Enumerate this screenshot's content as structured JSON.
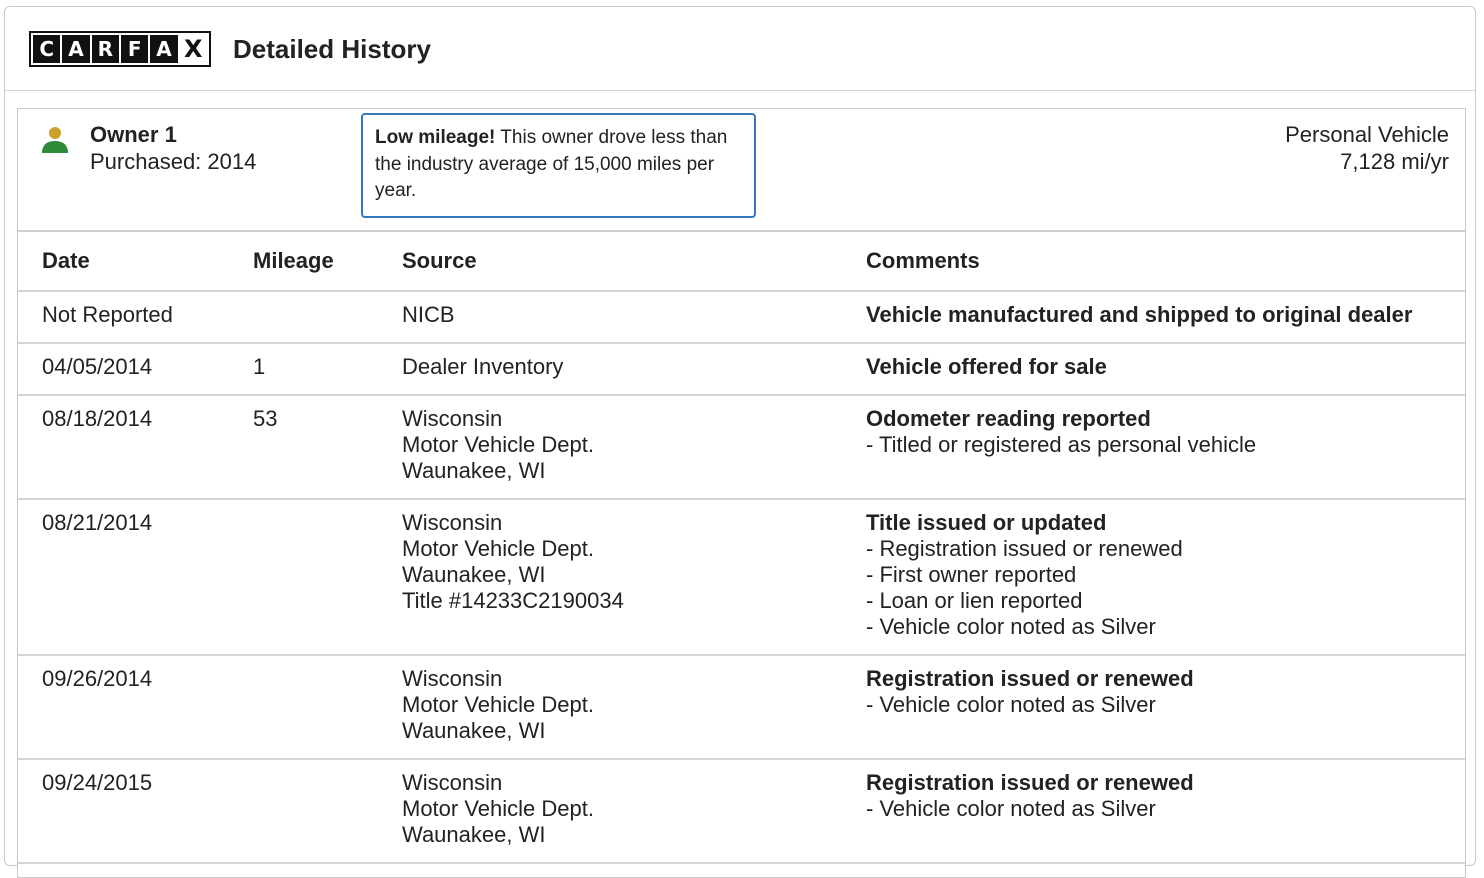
{
  "header": {
    "logo_letters": [
      "C",
      "A",
      "R",
      "F",
      "A",
      "X"
    ],
    "title": "Detailed History"
  },
  "owner": {
    "name": "Owner 1",
    "purchased": "Purchased: 2014",
    "icon": "person-icon",
    "icon_head_color": "#c9a227",
    "icon_body_color": "#2e8b3a",
    "vehicle_type": "Personal Vehicle",
    "mileage_rate": "7,128 mi/yr"
  },
  "notice": {
    "bold": "Low mileage!",
    "text": " This owner drove less than the industry average of 15,000 miles per year.",
    "border_color": "#3777bc"
  },
  "table": {
    "headers": {
      "date": "Date",
      "mileage": "Mileage",
      "source": "Source",
      "comments": "Comments"
    },
    "rows": [
      {
        "date": "Not Reported",
        "mileage": "",
        "source": [
          "NICB"
        ],
        "comment_title": "Vehicle manufactured and shipped to original dealer",
        "comment_details": []
      },
      {
        "date": "04/05/2014",
        "mileage": "1",
        "source": [
          "Dealer Inventory"
        ],
        "comment_title": "Vehicle offered for sale",
        "comment_details": []
      },
      {
        "date": "08/18/2014",
        "mileage": "53",
        "source": [
          "Wisconsin",
          "Motor Vehicle Dept.",
          "Waunakee, WI"
        ],
        "comment_title": "Odometer reading reported",
        "comment_details": [
          "- Titled or registered as personal vehicle"
        ]
      },
      {
        "date": "08/21/2014",
        "mileage": "",
        "source": [
          "Wisconsin",
          "Motor Vehicle Dept.",
          "Waunakee, WI",
          "Title #14233C2190034"
        ],
        "comment_title": "Title issued or updated",
        "comment_details": [
          "- Registration issued or renewed",
          "- First owner reported",
          "- Loan or lien reported",
          "- Vehicle color noted as Silver"
        ]
      },
      {
        "date": "09/26/2014",
        "mileage": "",
        "source": [
          "Wisconsin",
          "Motor Vehicle Dept.",
          "Waunakee, WI"
        ],
        "comment_title": "Registration issued or renewed",
        "comment_details": [
          "- Vehicle color noted as Silver"
        ]
      },
      {
        "date": "09/24/2015",
        "mileage": "",
        "source": [
          "Wisconsin",
          "Motor Vehicle Dept.",
          "Waunakee, WI"
        ],
        "comment_title": "Registration issued or renewed",
        "comment_details": [
          "- Vehicle color noted as Silver"
        ]
      }
    ]
  }
}
